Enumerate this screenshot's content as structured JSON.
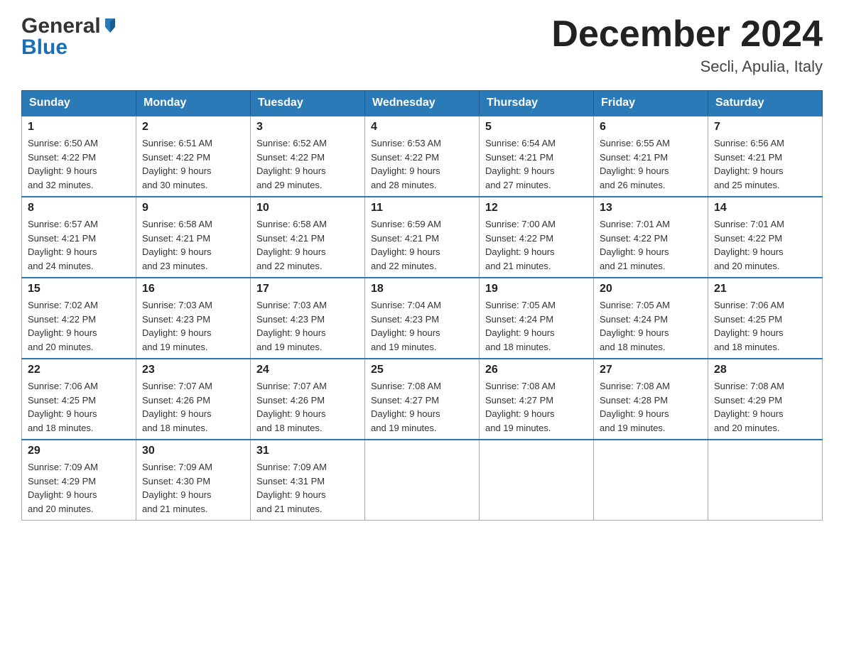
{
  "header": {
    "logo": {
      "general": "General",
      "blue": "Blue"
    },
    "title": "December 2024",
    "location": "Secli, Apulia, Italy"
  },
  "calendar": {
    "days_of_week": [
      "Sunday",
      "Monday",
      "Tuesday",
      "Wednesday",
      "Thursday",
      "Friday",
      "Saturday"
    ],
    "weeks": [
      [
        {
          "day": "1",
          "sunrise": "6:50 AM",
          "sunset": "4:22 PM",
          "daylight": "9 hours and 32 minutes."
        },
        {
          "day": "2",
          "sunrise": "6:51 AM",
          "sunset": "4:22 PM",
          "daylight": "9 hours and 30 minutes."
        },
        {
          "day": "3",
          "sunrise": "6:52 AM",
          "sunset": "4:22 PM",
          "daylight": "9 hours and 29 minutes."
        },
        {
          "day": "4",
          "sunrise": "6:53 AM",
          "sunset": "4:22 PM",
          "daylight": "9 hours and 28 minutes."
        },
        {
          "day": "5",
          "sunrise": "6:54 AM",
          "sunset": "4:21 PM",
          "daylight": "9 hours and 27 minutes."
        },
        {
          "day": "6",
          "sunrise": "6:55 AM",
          "sunset": "4:21 PM",
          "daylight": "9 hours and 26 minutes."
        },
        {
          "day": "7",
          "sunrise": "6:56 AM",
          "sunset": "4:21 PM",
          "daylight": "9 hours and 25 minutes."
        }
      ],
      [
        {
          "day": "8",
          "sunrise": "6:57 AM",
          "sunset": "4:21 PM",
          "daylight": "9 hours and 24 minutes."
        },
        {
          "day": "9",
          "sunrise": "6:58 AM",
          "sunset": "4:21 PM",
          "daylight": "9 hours and 23 minutes."
        },
        {
          "day": "10",
          "sunrise": "6:58 AM",
          "sunset": "4:21 PM",
          "daylight": "9 hours and 22 minutes."
        },
        {
          "day": "11",
          "sunrise": "6:59 AM",
          "sunset": "4:21 PM",
          "daylight": "9 hours and 22 minutes."
        },
        {
          "day": "12",
          "sunrise": "7:00 AM",
          "sunset": "4:22 PM",
          "daylight": "9 hours and 21 minutes."
        },
        {
          "day": "13",
          "sunrise": "7:01 AM",
          "sunset": "4:22 PM",
          "daylight": "9 hours and 21 minutes."
        },
        {
          "day": "14",
          "sunrise": "7:01 AM",
          "sunset": "4:22 PM",
          "daylight": "9 hours and 20 minutes."
        }
      ],
      [
        {
          "day": "15",
          "sunrise": "7:02 AM",
          "sunset": "4:22 PM",
          "daylight": "9 hours and 20 minutes."
        },
        {
          "day": "16",
          "sunrise": "7:03 AM",
          "sunset": "4:23 PM",
          "daylight": "9 hours and 19 minutes."
        },
        {
          "day": "17",
          "sunrise": "7:03 AM",
          "sunset": "4:23 PM",
          "daylight": "9 hours and 19 minutes."
        },
        {
          "day": "18",
          "sunrise": "7:04 AM",
          "sunset": "4:23 PM",
          "daylight": "9 hours and 19 minutes."
        },
        {
          "day": "19",
          "sunrise": "7:05 AM",
          "sunset": "4:24 PM",
          "daylight": "9 hours and 18 minutes."
        },
        {
          "day": "20",
          "sunrise": "7:05 AM",
          "sunset": "4:24 PM",
          "daylight": "9 hours and 18 minutes."
        },
        {
          "day": "21",
          "sunrise": "7:06 AM",
          "sunset": "4:25 PM",
          "daylight": "9 hours and 18 minutes."
        }
      ],
      [
        {
          "day": "22",
          "sunrise": "7:06 AM",
          "sunset": "4:25 PM",
          "daylight": "9 hours and 18 minutes."
        },
        {
          "day": "23",
          "sunrise": "7:07 AM",
          "sunset": "4:26 PM",
          "daylight": "9 hours and 18 minutes."
        },
        {
          "day": "24",
          "sunrise": "7:07 AM",
          "sunset": "4:26 PM",
          "daylight": "9 hours and 18 minutes."
        },
        {
          "day": "25",
          "sunrise": "7:08 AM",
          "sunset": "4:27 PM",
          "daylight": "9 hours and 19 minutes."
        },
        {
          "day": "26",
          "sunrise": "7:08 AM",
          "sunset": "4:27 PM",
          "daylight": "9 hours and 19 minutes."
        },
        {
          "day": "27",
          "sunrise": "7:08 AM",
          "sunset": "4:28 PM",
          "daylight": "9 hours and 19 minutes."
        },
        {
          "day": "28",
          "sunrise": "7:08 AM",
          "sunset": "4:29 PM",
          "daylight": "9 hours and 20 minutes."
        }
      ],
      [
        {
          "day": "29",
          "sunrise": "7:09 AM",
          "sunset": "4:29 PM",
          "daylight": "9 hours and 20 minutes."
        },
        {
          "day": "30",
          "sunrise": "7:09 AM",
          "sunset": "4:30 PM",
          "daylight": "9 hours and 21 minutes."
        },
        {
          "day": "31",
          "sunrise": "7:09 AM",
          "sunset": "4:31 PM",
          "daylight": "9 hours and 21 minutes."
        },
        null,
        null,
        null,
        null
      ]
    ],
    "labels": {
      "sunrise": "Sunrise:",
      "sunset": "Sunset:",
      "daylight": "Daylight:"
    }
  }
}
